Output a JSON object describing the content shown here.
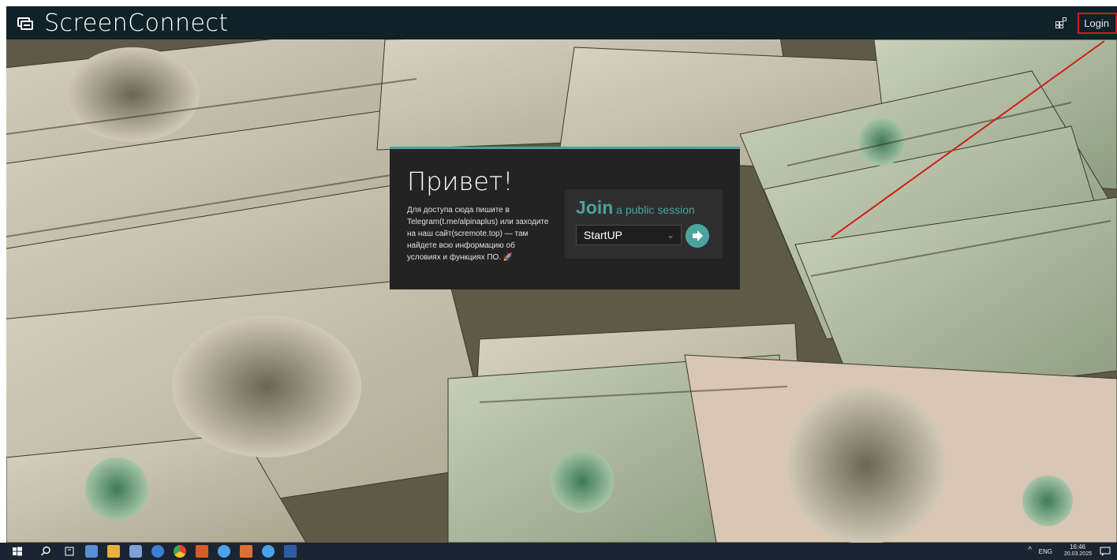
{
  "header": {
    "brand": "ScreenConnect",
    "login_label": "Login"
  },
  "dialog": {
    "title": "Привет!",
    "description": "Для доступа сюда пишите в Telegram(t.me/alpinaplus) или заходите на наш сайт(scremote.top) — там найдете всю информацию об условиях и функциях ПО. 🚀",
    "join": {
      "join_word": "Join",
      "join_rest": " a public session",
      "selected_session": "StartUP"
    }
  },
  "taskbar": {
    "icons": [
      "windows-start-icon",
      "search-icon",
      "task-view-icon",
      "app-icon",
      "file-explorer-icon",
      "app-icon",
      "app-icon",
      "chrome-icon",
      "app-icon",
      "app-icon",
      "app-icon",
      "app-icon",
      "word-icon"
    ],
    "lang": "ENG",
    "time": "16:46",
    "date": "20.03.2025"
  },
  "colors": {
    "topbar": "#0f2129",
    "accent": "#4aa39c",
    "dialog_bg": "#232323",
    "annotation_red": "#d21a1a"
  }
}
